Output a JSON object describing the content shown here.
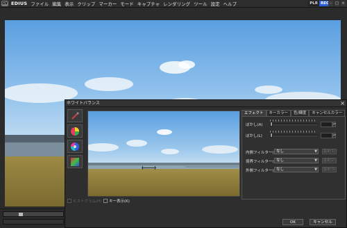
{
  "menubar": {
    "logo": "GV",
    "brand": "EDIUS",
    "items": [
      "ファイル",
      "編集",
      "表示",
      "クリップ",
      "マーカー",
      "モード",
      "キャプチャ",
      "レンダリング",
      "ツール",
      "設定",
      "ヘルプ"
    ],
    "plr": "PLR",
    "rec": "REC",
    "window_buttons": [
      "–",
      "□",
      "×"
    ]
  },
  "dialog": {
    "title": "ホワイトバランス",
    "close": "×",
    "tools": [
      "eyedropper-icon",
      "color-wheel-icon",
      "color-wheel-alt-icon",
      "color-gradient-icon"
    ],
    "checks": [
      {
        "label": "ヒストグラム(H)",
        "checked": false,
        "enabled": false
      },
      {
        "label": "キー表示(K)",
        "checked": false,
        "enabled": true
      }
    ],
    "tabs": [
      "エフェクト",
      "キーカラー",
      "色/輝度",
      "キャンセルカラー"
    ],
    "active_tab": 0,
    "sliders": [
      {
        "label": "ぼかし(A)",
        "value": 0
      },
      {
        "label": "ぼかし(L)",
        "value": 0
      }
    ],
    "filters": [
      {
        "label": "内側フィルター(I)",
        "value": "なし",
        "button": "設定(1)"
      },
      {
        "label": "境界フィルター(E)",
        "value": "なし",
        "button": "設定(2)"
      },
      {
        "label": "外側フィルター(O)",
        "value": "なし",
        "button": "設定(3)"
      }
    ],
    "ok": "OK",
    "cancel": "キャンセル"
  }
}
